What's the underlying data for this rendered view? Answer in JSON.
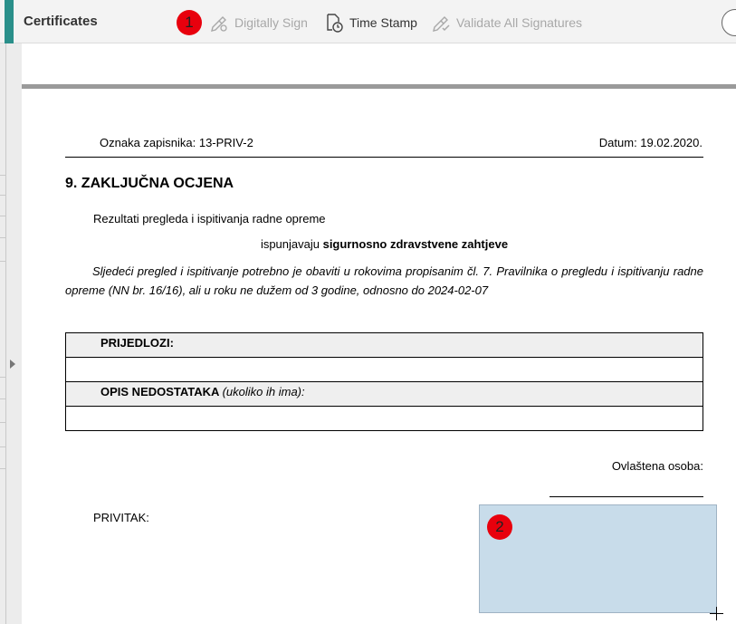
{
  "toolbar": {
    "title": "Certificates",
    "badge1": "1",
    "digitally_sign": "Digitally Sign",
    "time_stamp": "Time Stamp",
    "validate_all": "Validate All Signatures"
  },
  "document": {
    "record_label": "Oznaka zapisnika: 13-PRIV-2",
    "date_label": "Datum: 19.02.2020.",
    "section_title": "9.  ZAKLJUČNA OCJENA",
    "line1": "Rezultati pregleda i ispitivanja radne opreme",
    "line2_prefix": "ispunjavaju ",
    "line2_bold": "sigurnosno zdravstvene zahtjeve",
    "paragraph": "Sljedeći pregled i ispitivanje potrebno je obaviti u rokovima propisanim čl. 7. Pravilnika o pregledu i ispitivanju radne opreme (NN br. 16/16), ali u roku ne dužem od 3 godine, odnosno do 2024-02-07",
    "table": {
      "row1_label": "PRIJEDLOZI:",
      "row3_label": "OPIS NEDOSTATAKA",
      "row3_note": "(ukoliko ih ima):"
    },
    "signatory_label": "Ovlaštena osoba:",
    "attachment_label": "PRIVITAK:"
  },
  "signature_field": {
    "badge": "2",
    "color": "#c8dcea"
  },
  "colors": {
    "accent": "#2a8f8a",
    "badge": "#e8000d"
  }
}
